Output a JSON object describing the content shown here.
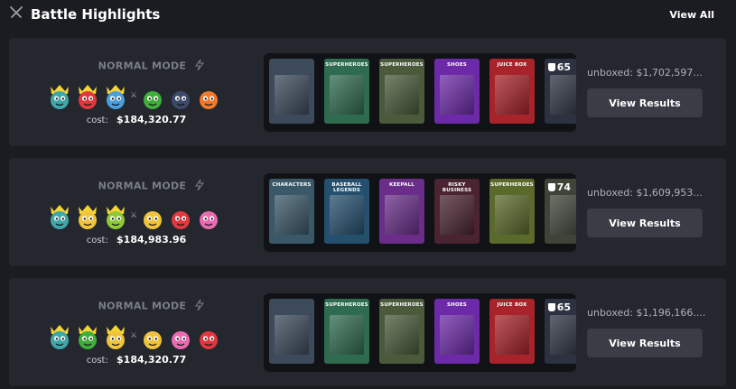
{
  "header": {
    "title": "Battle Highlights",
    "view_all": "View All",
    "icon": "crossed-swords-icon"
  },
  "battles": [
    {
      "mode": "NORMAL MODE",
      "cost_label": "cost:",
      "cost": "$184,320.77",
      "players": [
        {
          "face": "teal",
          "crown": true
        },
        {
          "face": "red",
          "crown": true
        },
        {
          "face": "blue",
          "crown": true
        },
        {
          "face": "green",
          "crown": false
        },
        {
          "face": "navy",
          "crown": false
        },
        {
          "face": "orange",
          "crown": false
        }
      ],
      "vs_index": 3,
      "boxes": [
        {
          "label": "",
          "color": "#3c4a5c"
        },
        {
          "label": "SUPERHEROES",
          "color": "#2f6b4f"
        },
        {
          "label": "SUPERHEROES",
          "color": "#4a5a3a"
        },
        {
          "label": "SHOES",
          "color": "#6d2aa8"
        },
        {
          "label": "JUICE BOX",
          "color": "#a8232a"
        },
        {
          "label": "",
          "color": "#2d3240"
        }
      ],
      "rounds": "65",
      "unboxed": "unboxed: $1,702,597...",
      "results_label": "View Results"
    },
    {
      "mode": "NORMAL MODE",
      "cost_label": "cost:",
      "cost": "$184,983.96",
      "players": [
        {
          "face": "teal",
          "crown": true
        },
        {
          "face": "yellow",
          "crown": true
        },
        {
          "face": "lime",
          "crown": true
        },
        {
          "face": "yellow",
          "crown": false
        },
        {
          "face": "red",
          "crown": false
        },
        {
          "face": "pink",
          "crown": false
        }
      ],
      "vs_index": 3,
      "boxes": [
        {
          "label": "CHARACTERS",
          "color": "#3a5868"
        },
        {
          "label": "BASEBALL LEGENDS",
          "color": "#24506e"
        },
        {
          "label": "KEEPALL",
          "color": "#6a2e8a"
        },
        {
          "label": "RISKY BUSINESS",
          "color": "#4a2430"
        },
        {
          "label": "SUPERHEROES",
          "color": "#5a6a2a"
        },
        {
          "label": "",
          "color": "#3e4438"
        }
      ],
      "rounds": "74",
      "unboxed": "unboxed: $1,609,953...",
      "results_label": "View Results"
    },
    {
      "mode": "NORMAL MODE",
      "cost_label": "cost:",
      "cost": "$184,320.77",
      "players": [
        {
          "face": "teal",
          "crown": true
        },
        {
          "face": "green",
          "crown": true
        },
        {
          "face": "yellow",
          "crown": true
        },
        {
          "face": "yellow",
          "crown": false
        },
        {
          "face": "pink",
          "crown": false
        },
        {
          "face": "red",
          "crown": false
        }
      ],
      "vs_index": 3,
      "boxes": [
        {
          "label": "",
          "color": "#3c4a5c"
        },
        {
          "label": "SUPERHEROES",
          "color": "#2f6b4f"
        },
        {
          "label": "SUPERHEROES",
          "color": "#4a5a3a"
        },
        {
          "label": "SHOES",
          "color": "#6d2aa8"
        },
        {
          "label": "JUICE BOX",
          "color": "#a8232a"
        },
        {
          "label": "",
          "color": "#2d3240"
        }
      ],
      "rounds": "65",
      "unboxed": "unboxed: $1,196,166....",
      "results_label": "View Results"
    }
  ],
  "colors": {
    "teal": "#3ea7a8",
    "red": "#e0383e",
    "blue": "#4a9fdc",
    "green": "#3fae3b",
    "navy": "#3b4a6b",
    "orange": "#f07a2b",
    "yellow": "#f0c43a",
    "lime": "#8ec936",
    "pink": "#e86ab0",
    "crown": "#f6d431"
  }
}
